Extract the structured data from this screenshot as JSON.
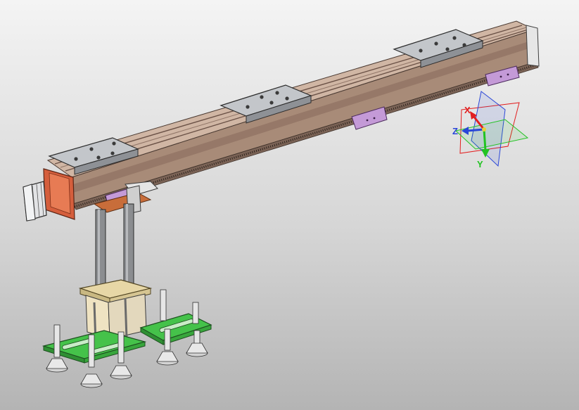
{
  "viewport": {
    "background_top": "#f4f4f4",
    "background_bottom": "#b4b4b4"
  },
  "model": {
    "rail_color": "#c8ab96",
    "rail_dark": "#7a5d4c",
    "carriage_color": "#b9bcc1",
    "motor_color": "#d4d6d8",
    "bracket_colors": [
      "#d55e3c",
      "#c86d3a",
      "#c49ad7"
    ],
    "column_color": "#8b8d90",
    "cylinder_block_color": "#e7d7a6",
    "plate_color": "#45c24a",
    "cup_color": "#dcdcdc"
  },
  "triad": {
    "x_label": "X",
    "y_label": "Y",
    "z_label": "Z",
    "x_color": "#e21e1e",
    "y_color": "#22c322",
    "z_color": "#2a46d8"
  }
}
